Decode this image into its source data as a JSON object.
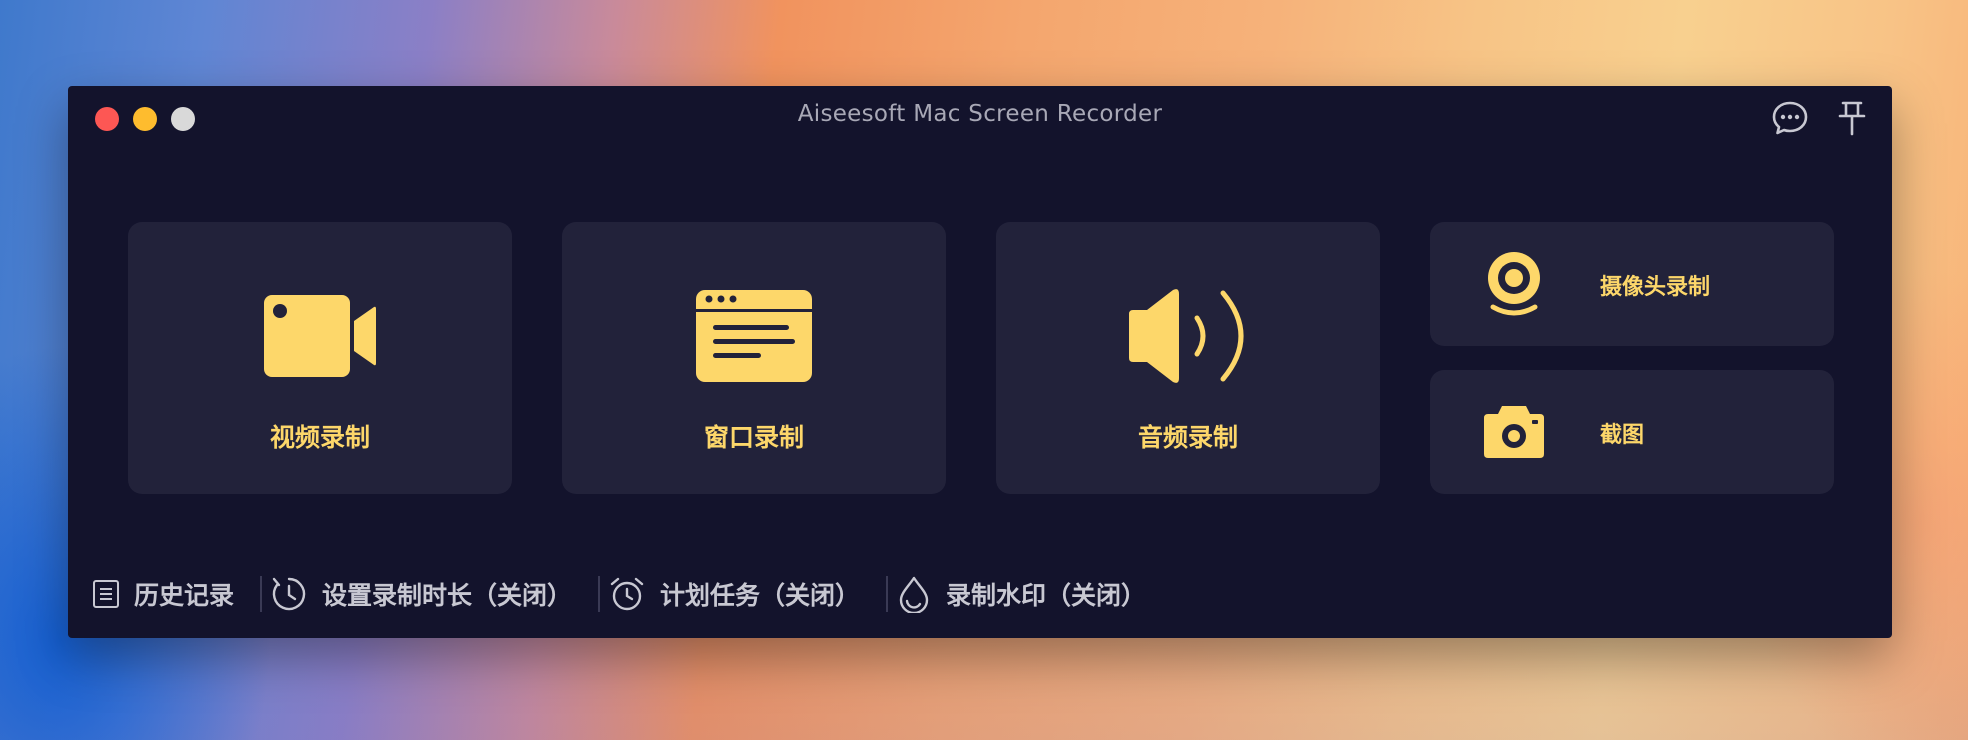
{
  "window": {
    "title": "Aiseesoft Mac Screen Recorder"
  },
  "toolbar_icons": [
    "chat-bubble-icon",
    "pin-icon"
  ],
  "cards": {
    "video": {
      "label": "视频录制",
      "icon": "video-camera-icon"
    },
    "window": {
      "label": "窗口录制",
      "icon": "browser-window-icon"
    },
    "audio": {
      "label": "音频录制",
      "icon": "speaker-icon"
    },
    "webcam": {
      "label": "摄像头录制",
      "icon": "webcam-icon"
    },
    "snapshot": {
      "label": "截图",
      "icon": "camera-icon"
    }
  },
  "bottom_bar": {
    "history": "历史记录",
    "record_length": "设置录制时长（关闭）",
    "schedule": "计划任务（关闭）",
    "watermark": "录制水印（关闭）"
  },
  "colors": {
    "accent": "#fdd76a",
    "window_bg": "#13132c",
    "card_bg": "#22223a",
    "muted_text": "#c8c8d2"
  }
}
